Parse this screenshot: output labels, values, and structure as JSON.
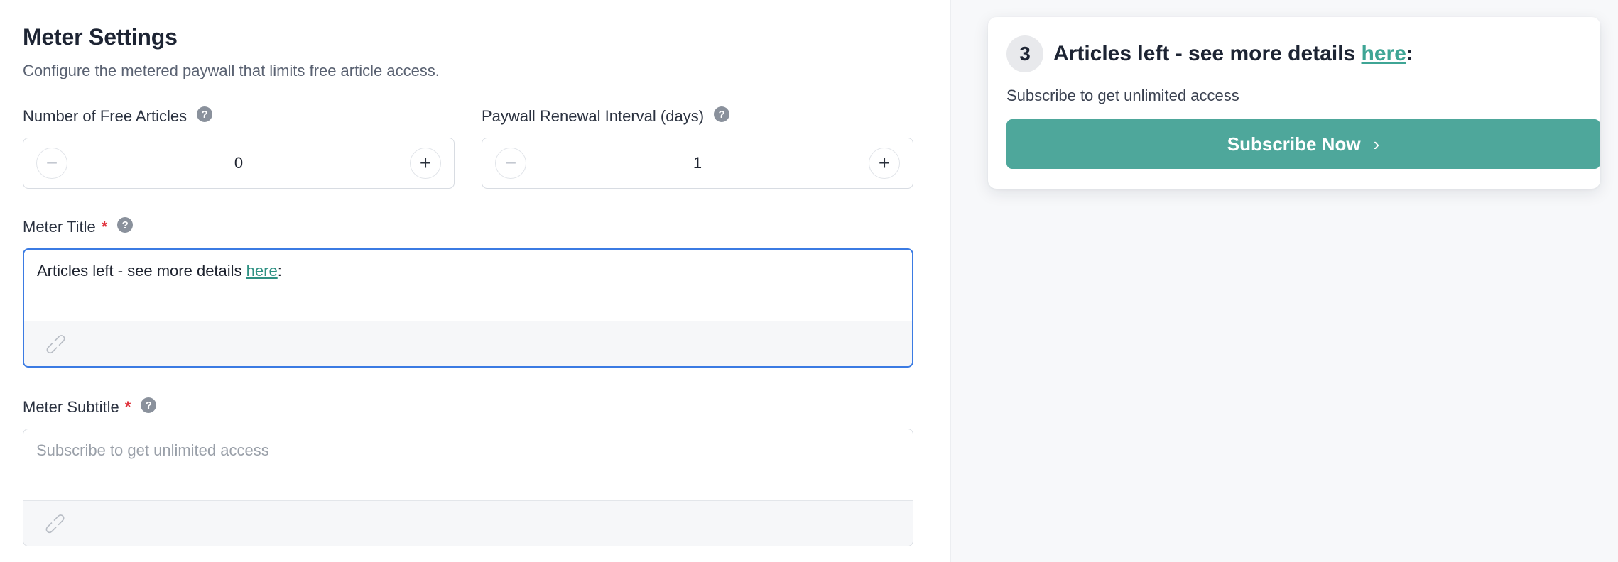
{
  "settings": {
    "title": "Meter Settings",
    "description": "Configure the metered paywall that limits free article access.",
    "free_articles": {
      "label": "Number of Free Articles",
      "value": "0",
      "minus_icon": "minus-icon",
      "plus_icon": "plus-icon"
    },
    "renewal_interval": {
      "label": "Paywall Renewal Interval (days)",
      "value": "1"
    },
    "meter_title": {
      "label": "Meter Title",
      "required_mark": "*",
      "text_before_link": "Articles left - see more details ",
      "link_text": "here",
      "text_after_link": ":"
    },
    "meter_subtitle": {
      "label": "Meter Subtitle",
      "required_mark": "*",
      "placeholder": "Subscribe to get unlimited access"
    },
    "help_glyph": "?",
    "minus_glyph": "−",
    "plus_glyph": "+",
    "link_glyph": "⊂⊃"
  },
  "preview": {
    "count": "3",
    "title_before_link": "Articles left - see more details ",
    "title_link": "here",
    "title_after_link": ":",
    "subtitle": "Subscribe to get unlimited access",
    "button_label": "Subscribe Now",
    "button_chevron": "›"
  },
  "colors": {
    "accent": "#4ea79b",
    "link": "#2f9183",
    "focus": "#3b7be3",
    "required": "#e0303a"
  }
}
